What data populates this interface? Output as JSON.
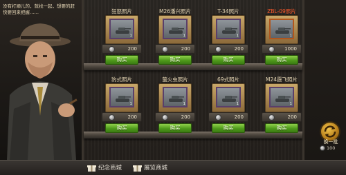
{
  "dialog": {
    "text": "没有打顺儿的，就找一起，想要的赶快要回来把握……"
  },
  "cards": [
    {
      "title": "狂怒照片",
      "count": "1",
      "price": "200",
      "buy_label": "购买",
      "title_color": "normal",
      "border": "purple"
    },
    {
      "title": "M26潘兴照片",
      "count": "1",
      "price": "200",
      "buy_label": "购买",
      "title_color": "normal",
      "border": "purple"
    },
    {
      "title": "T-34照片",
      "count": "1",
      "price": "200",
      "buy_label": "购买",
      "title_color": "normal",
      "border": "purple"
    },
    {
      "title": "ZBL-09照片",
      "count": "1",
      "price": "1000",
      "buy_label": "购买",
      "title_color": "red",
      "border": "orange"
    },
    {
      "title": "豹式照片",
      "count": "1",
      "price": "200",
      "buy_label": "购买",
      "title_color": "normal",
      "border": "purple"
    },
    {
      "title": "萤火虫照片",
      "count": "1",
      "price": "200",
      "buy_label": "购买",
      "title_color": "normal",
      "border": "purple"
    },
    {
      "title": "69式照片",
      "count": "1",
      "price": "200",
      "buy_label": "购买",
      "title_color": "normal",
      "border": "purple"
    },
    {
      "title": "M24霞飞照片",
      "count": "1",
      "price": "200",
      "buy_label": "购买",
      "title_color": "normal",
      "border": "purple"
    }
  ],
  "refresh": {
    "label": "换一批",
    "cost": "100"
  },
  "tabs": [
    {
      "label": "纪念商城",
      "icon": "gift-icon"
    },
    {
      "label": "展览商城",
      "icon": "gift-icon"
    }
  ],
  "colors": {
    "buy_green": "#4f9a1c",
    "title_red": "#ff5a2a",
    "title_normal": "#e6d7b5",
    "frame_gold": "#c9a86a"
  }
}
